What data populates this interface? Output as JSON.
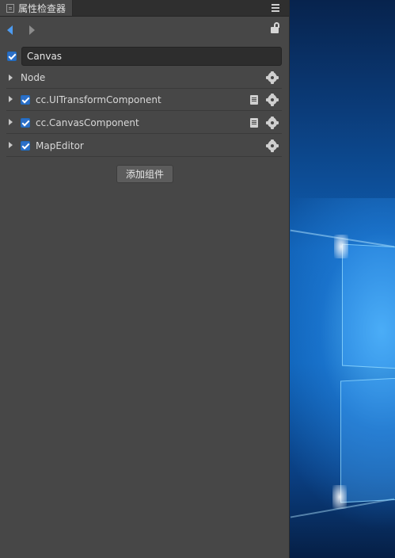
{
  "panel": {
    "tab_title": "属性检查器",
    "node_name": "Canvas",
    "node_active": true
  },
  "components": [
    {
      "label": "Node",
      "has_checkbox": false,
      "has_doc": false
    },
    {
      "label": "cc.UITransformComponent",
      "has_checkbox": true,
      "checked": true,
      "has_doc": true
    },
    {
      "label": "cc.CanvasComponent",
      "has_checkbox": true,
      "checked": true,
      "has_doc": true
    },
    {
      "label": "MapEditor",
      "has_checkbox": true,
      "checked": true,
      "has_doc": false
    }
  ],
  "add_component_label": "添加组件",
  "colors": {
    "panel_bg": "#474747",
    "accent": "#2c6fc7"
  }
}
